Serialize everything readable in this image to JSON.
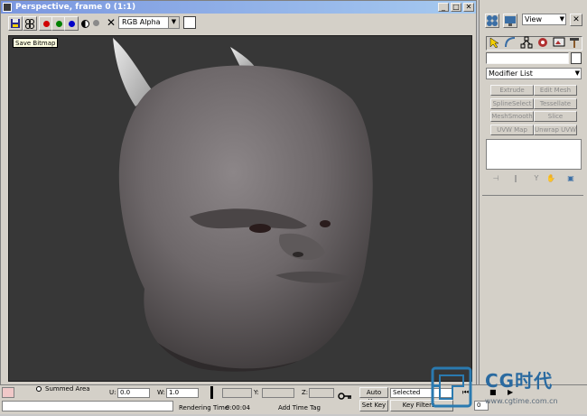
{
  "window": {
    "title": "Perspective, frame 0 (1:1)",
    "minimize_glyph": "_",
    "maximize_glyph": "□",
    "close_glyph": "✕"
  },
  "toolbar": {
    "channel_select": "RGB Alpha",
    "clear_glyph": "✕",
    "channel_colors": {
      "red": "#d00000",
      "green": "#008000",
      "blue": "#0000c8",
      "mono": "#8a8a8a"
    }
  },
  "viewport": {
    "tooltip": "Save Bitmap",
    "background": "#373737",
    "subject": "rendered creature head"
  },
  "command_panel": {
    "display_select": "View",
    "modifier_list": "Modifier List",
    "modifiers": [
      "Extrude",
      "Edit Mesh",
      "SplineSelect",
      "Tessellate",
      "MeshSmooth",
      "Slice",
      "UVW Map",
      "Unwrap UVW"
    ]
  },
  "status": {
    "summed_area_label": "Summed Area",
    "u_label": "U:",
    "u_value": "0.0",
    "w_label": "W:",
    "w_value": "1.0",
    "y_label": "Y:",
    "z_label": "Z:",
    "auto_key": "Auto Key",
    "set_key": "Set Key",
    "selected": "Selected",
    "key_filters": "Key Filters...",
    "rendering_time_label": "Rendering Time",
    "rendering_time_value": "0:00:04",
    "add_time_tag": "Add Time Tag",
    "frame_value": "0"
  },
  "watermark": {
    "brand": "CG时代",
    "url": "www.cgtime.com.cn"
  }
}
